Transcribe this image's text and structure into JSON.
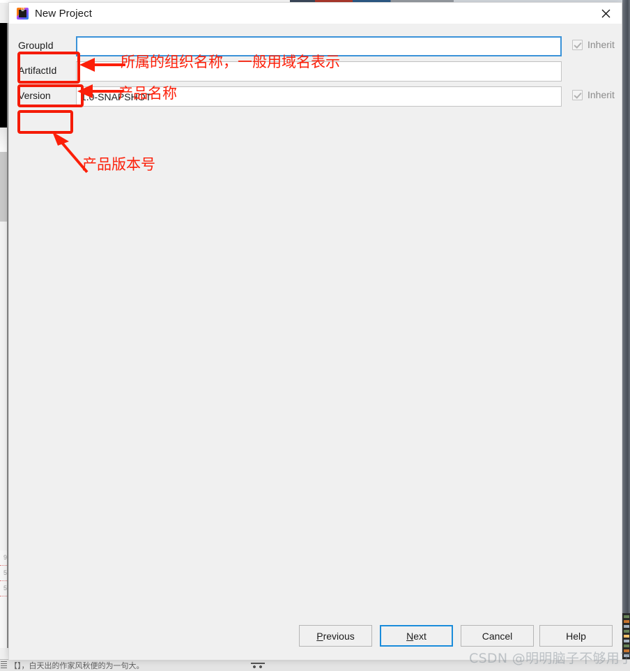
{
  "window": {
    "title": "New Project",
    "app_icon": "intellij-idea-icon",
    "close_icon": "close-icon"
  },
  "form": {
    "rows": [
      {
        "label": "GroupId",
        "value": "",
        "focused": true,
        "inherit": {
          "label": "Inherit",
          "checked": true,
          "enabled": false
        }
      },
      {
        "label": "ArtifactId",
        "value": "",
        "focused": false,
        "inherit": null
      },
      {
        "label": "Version",
        "value": "1.0-SNAPSHOT",
        "focused": false,
        "inherit": {
          "label": "Inherit",
          "checked": true,
          "enabled": false
        }
      }
    ]
  },
  "annotations": {
    "color": "#fc1f09",
    "notes": [
      {
        "text": "所属的组织名称，一般用域名表示",
        "target": "GroupId"
      },
      {
        "text": "产品名称",
        "target": "ArtifactId"
      },
      {
        "text": "产品版本号",
        "target": "Version"
      }
    ]
  },
  "footer": {
    "buttons": [
      {
        "name": "previous",
        "label_before": "",
        "mnemonic": "P",
        "label_after": "revious",
        "default": false
      },
      {
        "name": "next",
        "label_before": "",
        "mnemonic": "N",
        "label_after": "ext",
        "default": true
      },
      {
        "name": "cancel",
        "label_before": "Cancel",
        "mnemonic": "",
        "label_after": "",
        "default": false
      },
      {
        "name": "help",
        "label_before": "Help",
        "mnemonic": "",
        "label_after": "",
        "default": false
      }
    ]
  },
  "watermark": {
    "text": "CSDN @明明脑子不够用了"
  },
  "background": {
    "editor_line_numbers": [
      "9",
      "5",
      "5"
    ],
    "status_text": "【】，白天出的作家风秋便的为一句大。"
  }
}
